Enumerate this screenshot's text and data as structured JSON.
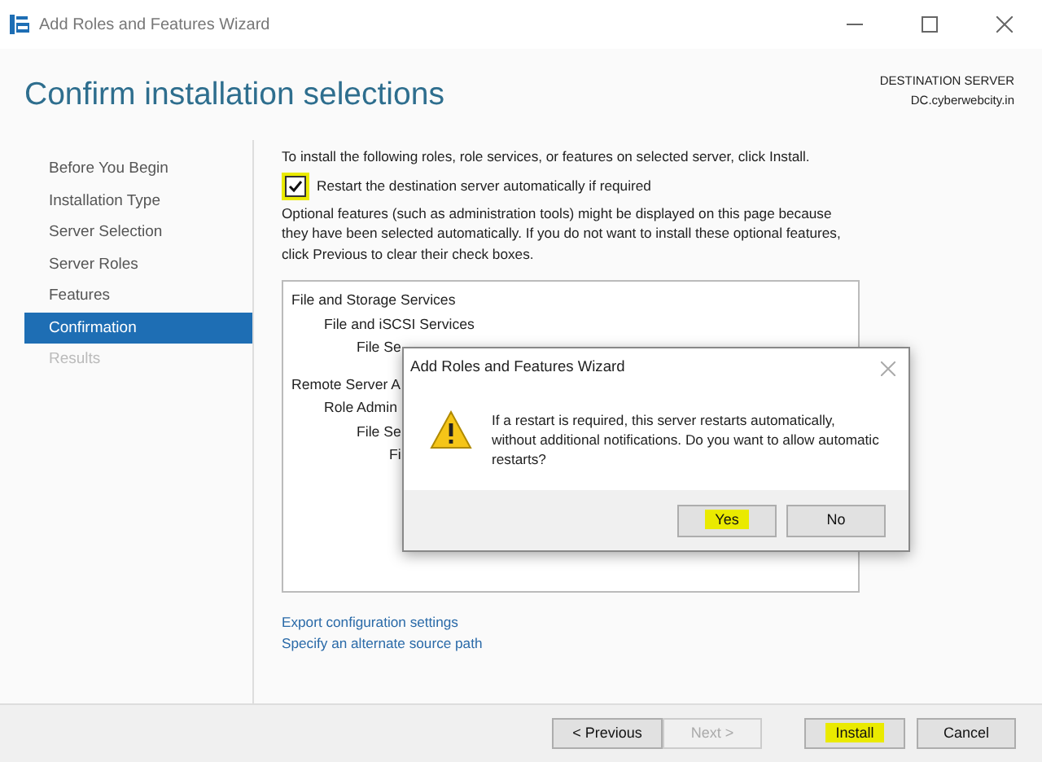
{
  "window": {
    "title": "Add Roles and Features Wizard"
  },
  "header": {
    "title": "Confirm installation selections",
    "destination_label": "DESTINATION SERVER",
    "destination_server": "DC.cyberwebcity.in"
  },
  "nav": [
    {
      "label": "Before You Begin",
      "selected": false,
      "disabled": false
    },
    {
      "label": "Installation Type",
      "selected": false,
      "disabled": false
    },
    {
      "label": "Server Selection",
      "selected": false,
      "disabled": false
    },
    {
      "label": "Server Roles",
      "selected": false,
      "disabled": false
    },
    {
      "label": "Features",
      "selected": false,
      "disabled": false
    },
    {
      "label": "Confirmation",
      "selected": true,
      "disabled": false
    },
    {
      "label": "Results",
      "selected": false,
      "disabled": true
    }
  ],
  "intro": "To install the following roles, role services, or features on selected server, click Install.",
  "restart_checkbox": {
    "label": "Restart the destination server automatically if required",
    "checked": true,
    "highlighted": true
  },
  "note": "Optional features (such as administration tools) might be displayed on this page because they have been selected automatically. If you do not want to install these optional features, click Previous to clear their check boxes.",
  "selections": [
    {
      "label": "File and Storage Services",
      "children": [
        {
          "label": "File and iSCSI Services",
          "children": [
            {
              "label": "File Se"
            }
          ]
        }
      ]
    },
    {
      "label": "Remote Server A",
      "children": [
        {
          "label": "Role Admin",
          "children": [
            {
              "label": "File Se",
              "children": [
                {
                  "label": "Fi"
                }
              ]
            }
          ]
        }
      ]
    }
  ],
  "links": [
    "Export configuration settings",
    "Specify an alternate source path"
  ],
  "buttons": [
    {
      "label": "< Previous",
      "disabled": false,
      "highlighted": false
    },
    {
      "label": "Next >",
      "disabled": true,
      "highlighted": false
    },
    {
      "label": "Install",
      "disabled": false,
      "highlighted": true
    },
    {
      "label": "Cancel",
      "disabled": false,
      "highlighted": false
    }
  ],
  "dialog": {
    "title": "Add Roles and Features Wizard",
    "message": "If a restart is required, this server restarts automatically, without additional notifications. Do you want to allow automatic restarts?",
    "buttons": [
      {
        "label": "Yes",
        "highlighted": true
      },
      {
        "label": "No",
        "highlighted": false
      }
    ]
  }
}
